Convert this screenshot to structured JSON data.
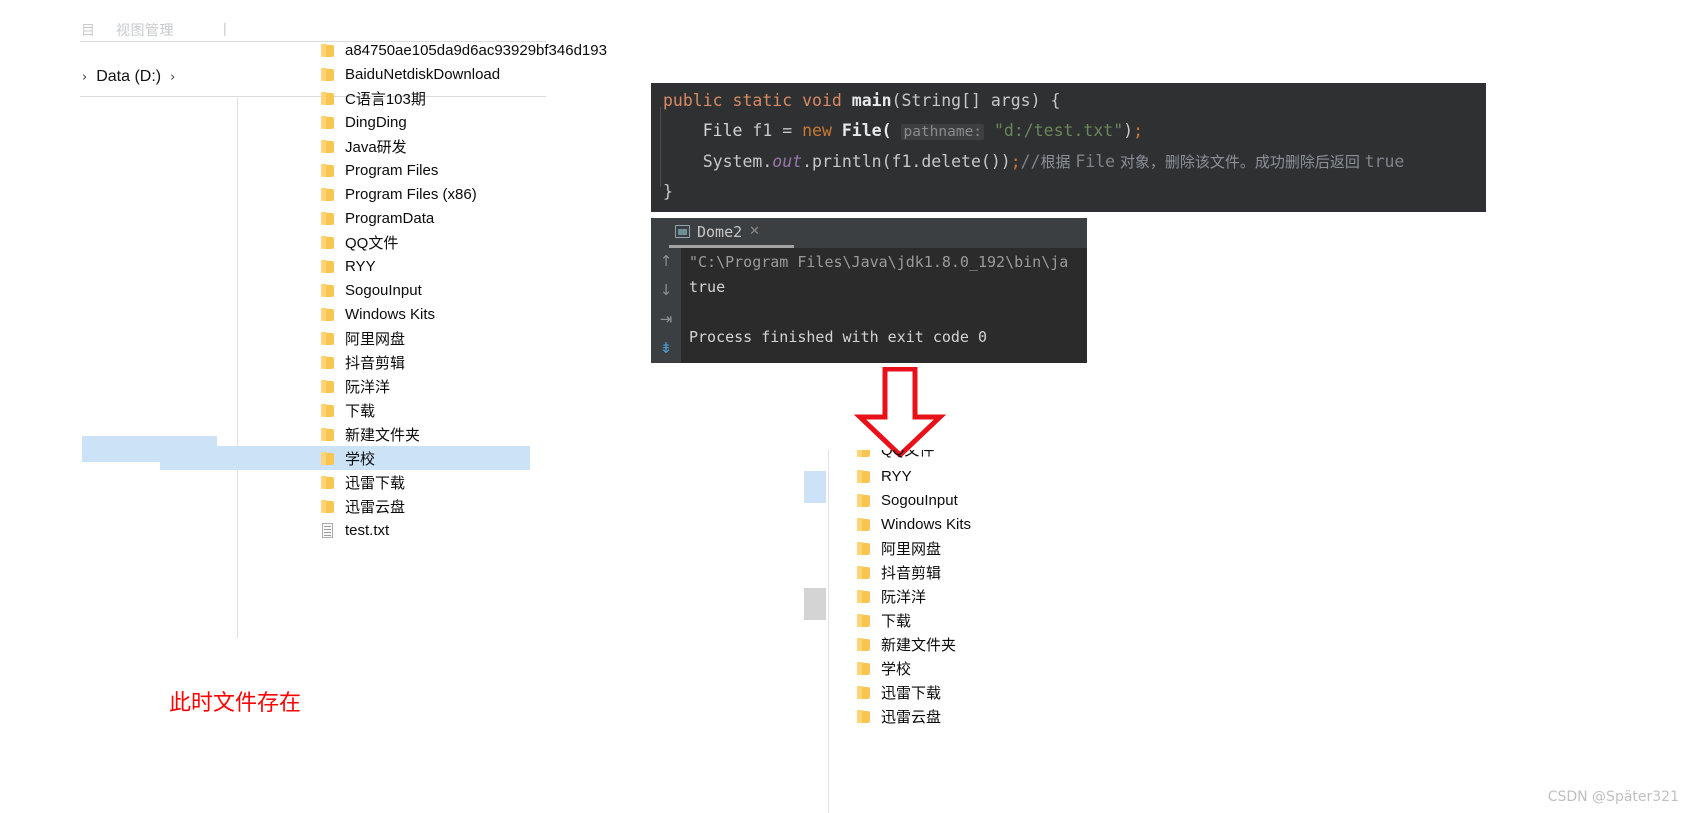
{
  "left_explorer": {
    "ribbon_ghost_fragments": [
      "目",
      "视图管理",
      "|"
    ],
    "breadcrumb": {
      "leading_chevron": "›",
      "label": "Data (D:)",
      "trailing_chevron": "›"
    },
    "items": [
      {
        "name": "a84750ae105da9d6ac93929bf346d193",
        "icon": "folder-icon",
        "selected": false
      },
      {
        "name": "BaiduNetdiskDownload",
        "icon": "folder-icon",
        "selected": false
      },
      {
        "name": "C语言103期",
        "icon": "folder-icon",
        "selected": false
      },
      {
        "name": "DingDing",
        "icon": "folder-icon",
        "selected": false
      },
      {
        "name": "Java研发",
        "icon": "folder-icon",
        "selected": false
      },
      {
        "name": "Program Files",
        "icon": "folder-icon",
        "selected": false
      },
      {
        "name": "Program Files (x86)",
        "icon": "folder-icon",
        "selected": false
      },
      {
        "name": "ProgramData",
        "icon": "folder-icon",
        "selected": false
      },
      {
        "name": "QQ文件",
        "icon": "folder-icon",
        "selected": false
      },
      {
        "name": "RYY",
        "icon": "folder-icon",
        "selected": false
      },
      {
        "name": "SogouInput",
        "icon": "folder-icon",
        "selected": false
      },
      {
        "name": "Windows Kits",
        "icon": "folder-icon",
        "selected": false
      },
      {
        "name": "阿里网盘",
        "icon": "folder-icon",
        "selected": false
      },
      {
        "name": "抖音剪辑",
        "icon": "folder-icon",
        "selected": false
      },
      {
        "name": "阮洋洋",
        "icon": "folder-icon",
        "selected": false
      },
      {
        "name": "下载",
        "icon": "folder-icon",
        "selected": false
      },
      {
        "name": "新建文件夹",
        "icon": "folder-icon",
        "selected": false
      },
      {
        "name": "学校",
        "icon": "folder-icon",
        "selected": true
      },
      {
        "name": "迅雷下载",
        "icon": "folder-icon",
        "selected": false
      },
      {
        "name": "迅雷云盘",
        "icon": "folder-icon",
        "selected": false
      },
      {
        "name": "test.txt",
        "icon": "text-file-icon",
        "selected": false
      }
    ],
    "annotation": "此时文件存在"
  },
  "code_editor": {
    "line1": {
      "kw_public": "public",
      "kw_static": "static",
      "kw_void": "void",
      "method": "main",
      "params": "(String[] args) {"
    },
    "line2": {
      "type": "File",
      "var": " f1 = ",
      "kw_new": "new",
      "ctor": " File(",
      "hint": "pathname:",
      "string": "\"d:/test.txt\"",
      "tail_paren": ")",
      "semicolon": ";"
    },
    "line3": {
      "head": "System.",
      "field": "out",
      "call": ".println(f1.delete())",
      "semicolon": ";",
      "comment_slash": "//",
      "comment_cn_a": "根据 ",
      "comment_code": "File",
      "comment_cn_b": " 对象，删除该文件。成功删除后返回 ",
      "comment_true": "true"
    },
    "line4": "}"
  },
  "console": {
    "tab_label": "Dome2",
    "tab_close": "✕",
    "tab_icon": "run-window-icon",
    "sidebar_buttons": [
      {
        "icon": "arrow-up-icon",
        "glyph": "↑",
        "active": false
      },
      {
        "icon": "arrow-down-icon",
        "glyph": "↓",
        "active": false
      },
      {
        "icon": "soft-wrap-icon",
        "glyph": "⇥",
        "active": false
      },
      {
        "icon": "scroll-to-end-icon",
        "glyph": "⇟",
        "active": true
      }
    ],
    "output": {
      "command_line": "\"C:\\Program Files\\Java\\jdk1.8.0_192\\bin\\ja",
      "result": "true",
      "blank": "",
      "exit_line": "Process finished with exit code 0"
    }
  },
  "arrow": {
    "name": "red-down-arrow",
    "color": "#e8111a"
  },
  "right_explorer": {
    "clipped_top_item": "QQ文件",
    "items": [
      {
        "name": "RYY",
        "icon": "folder-icon"
      },
      {
        "name": "SogouInput",
        "icon": "folder-icon"
      },
      {
        "name": "Windows Kits",
        "icon": "folder-icon"
      },
      {
        "name": "阿里网盘",
        "icon": "folder-icon"
      },
      {
        "name": "抖音剪辑",
        "icon": "folder-icon"
      },
      {
        "name": "阮洋洋",
        "icon": "folder-icon"
      },
      {
        "name": "下载",
        "icon": "folder-icon"
      },
      {
        "name": "新建文件夹",
        "icon": "folder-icon"
      },
      {
        "name": "学校",
        "icon": "folder-icon"
      },
      {
        "name": "迅雷下载",
        "icon": "folder-icon"
      },
      {
        "name": "迅雷云盘",
        "icon": "folder-icon"
      }
    ]
  },
  "watermark": "CSDN @Später321"
}
